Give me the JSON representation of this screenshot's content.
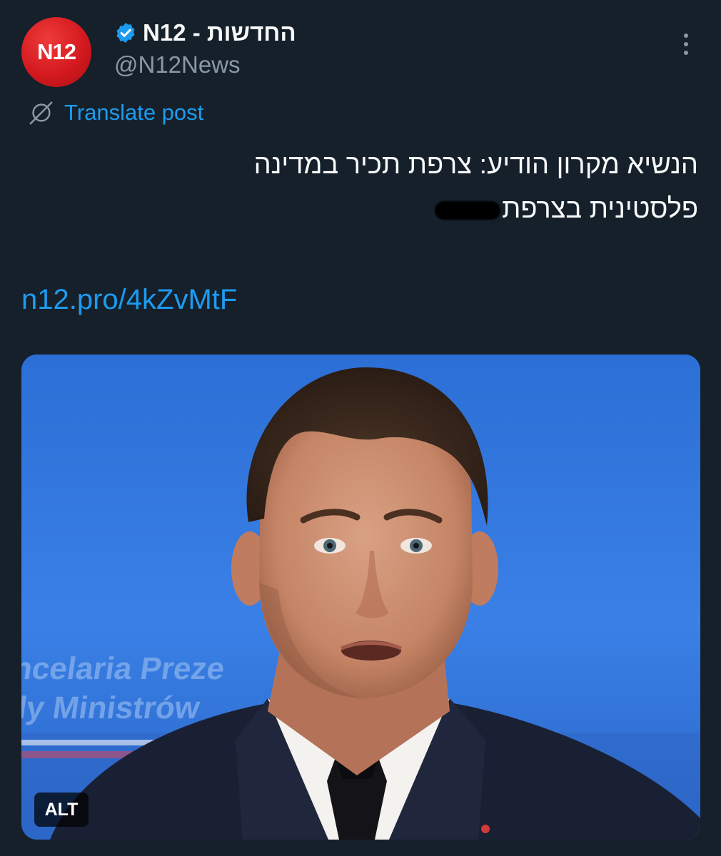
{
  "author": {
    "avatar_text": "N12",
    "display_name": "N12 - החדשות",
    "handle": "@N12News",
    "verified": true
  },
  "actions": {
    "more_icon": "more-vertical-icon",
    "translate_label": "Translate post",
    "translate_icon": "globe-translate-icon"
  },
  "tweet": {
    "line1": "הנשיא מקרון הודיע: צרפת תכיר במדינה",
    "line2": "פלסטינית בצרפת",
    "link": "n12.pro/4kZvMtF"
  },
  "media": {
    "alt_label": "ALT",
    "background_text_1": "Kancelaria Preze",
    "background_text_2": "Rady Ministrów"
  },
  "colors": {
    "background": "#15202b",
    "link": "#1d9bf0",
    "secondary_text": "#8b98a5",
    "avatar_red": "#d41a1f"
  }
}
